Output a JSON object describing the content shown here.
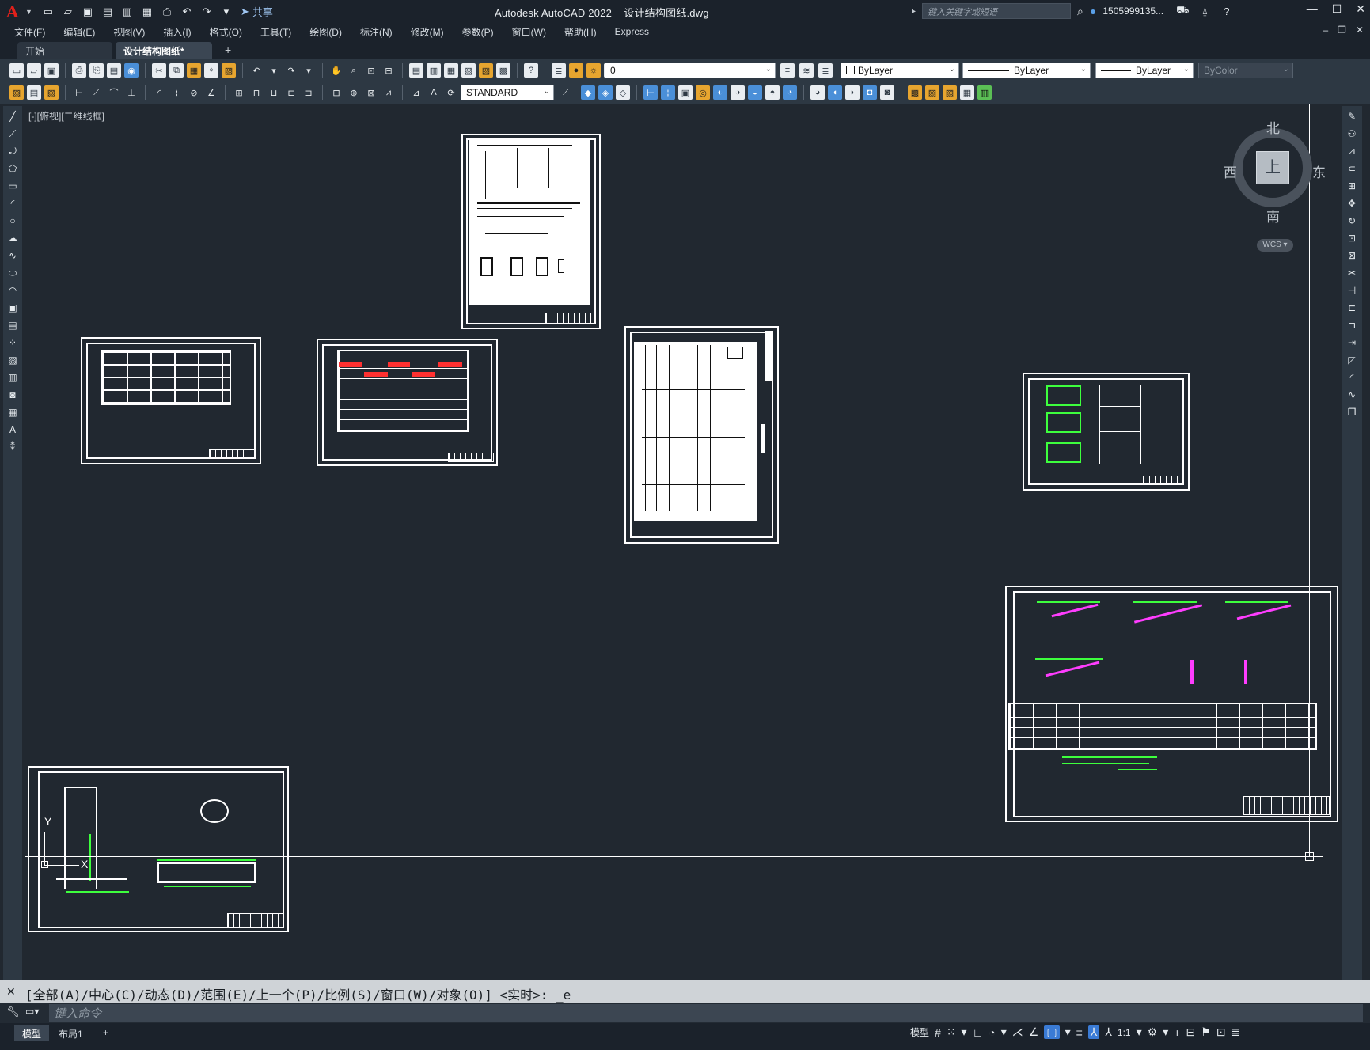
{
  "title": {
    "app_name": "Autodesk AutoCAD 2022",
    "file_name": "设计结构图纸.dwg",
    "share_label": "共享",
    "search_placeholder": "键入关键字或短语",
    "user_name": "1505999135...",
    "min": "—",
    "restore": "☐",
    "close": "✕"
  },
  "menu": {
    "items": [
      "文件(F)",
      "编辑(E)",
      "视图(V)",
      "插入(I)",
      "格式(O)",
      "工具(T)",
      "绘图(D)",
      "标注(N)",
      "修改(M)",
      "参数(P)",
      "窗口(W)",
      "帮助(H)",
      "Express"
    ]
  },
  "tabs": {
    "start": "开始",
    "active": "设计结构图纸*",
    "close": "✕",
    "add": "+"
  },
  "toolbar": {
    "layer_value": "0",
    "color_value": "ByLayer",
    "linetype_value": "ByLayer",
    "lineweight_value": "ByLayer",
    "plotstyle_value": "ByColor",
    "textstyle_value": "STANDARD"
  },
  "viewport": {
    "label": "[-][俯视][二维线框]"
  },
  "viewcube": {
    "north": "北",
    "south": "南",
    "east": "东",
    "west": "西",
    "face": "上",
    "wcs": "WCS"
  },
  "command": {
    "history": "[全部(A)/中心(C)/动态(D)/范围(E)/上一个(P)/比例(S)/窗口(W)/对象(O)] <实时>: _e",
    "placeholder": "键入命令"
  },
  "status": {
    "model_tab": "模型",
    "layout_tab": "布局1",
    "add_layout": "+",
    "model_label": "模型",
    "scale": "1:1"
  },
  "colors": {
    "background": "#212830",
    "toolbar": "#2d3843",
    "accent": "#3a7bd5",
    "green_lines": "#3dff3d",
    "magenta_lines": "#ff3dff"
  }
}
